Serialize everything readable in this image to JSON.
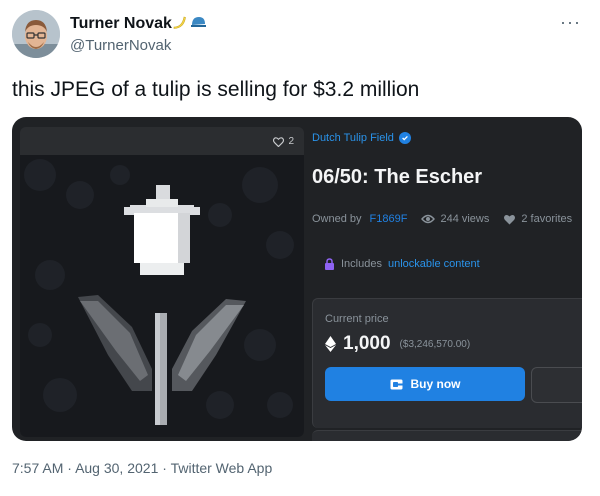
{
  "author": {
    "name": "Turner Novak",
    "handle": "@TurnerNovak",
    "emoji_icons": [
      "banana-icon",
      "cap-icon"
    ]
  },
  "tweet": {
    "text": "this JPEG of a tulip is selling for $3.2 million"
  },
  "listing": {
    "favorites_badge": "2",
    "collection": "Dutch Tulip Field",
    "title": "06/50: The Escher",
    "owned_by_label": "Owned by",
    "owner": "F1869F",
    "views": "244 views",
    "favorites": "2 favorites",
    "unlock_prefix": "Includes",
    "unlock_link": "unlockable content",
    "price_label": "Current price",
    "price": "1,000",
    "price_usd": "($3,246,570.00)",
    "buy_label": "Buy now"
  },
  "footer": {
    "time": "7:57 AM",
    "sep1": "·",
    "date": "Aug 30, 2021",
    "sep2": "·",
    "source": "Twitter Web App"
  },
  "colors": {
    "accent": "#2081e2",
    "card_bg": "#202225",
    "unlock_icon": "#8e63f2"
  }
}
